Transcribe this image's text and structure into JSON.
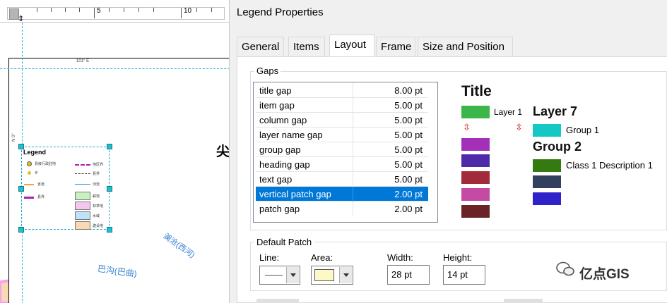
{
  "map": {
    "ruler": {
      "labels": [
        "5",
        "10"
      ]
    },
    "coord_top": "101° E",
    "coord_left": "N 0°",
    "place_label": "尖",
    "river_labels": [
      "巴沟(巴曲)",
      "澜沧(西河)"
    ],
    "legend": {
      "title": "Legend",
      "left_items": [
        "县级行政驻地",
        "乡",
        "省道",
        "县界"
      ],
      "mid_items": [
        "地区界",
        "县界",
        "河流"
      ],
      "swatch_labels": [
        "耕地",
        "林草地",
        "水域",
        "建设地"
      ]
    }
  },
  "dialog": {
    "title": "Legend Properties",
    "tabs": [
      {
        "label": "General"
      },
      {
        "label": "Items"
      },
      {
        "label": "Layout"
      },
      {
        "label": "Frame"
      },
      {
        "label": "Size and Position"
      }
    ],
    "active_tab": "Layout",
    "gaps": {
      "label": "Gaps",
      "rows": [
        {
          "name": "title gap",
          "value": "8.00 pt"
        },
        {
          "name": "item gap",
          "value": "5.00 pt"
        },
        {
          "name": "column gap",
          "value": "5.00 pt"
        },
        {
          "name": "layer name gap",
          "value": "5.00 pt"
        },
        {
          "name": "group gap",
          "value": "5.00 pt"
        },
        {
          "name": "heading gap",
          "value": "5.00 pt"
        },
        {
          "name": "text gap",
          "value": "5.00 pt"
        },
        {
          "name": "vertical patch gap",
          "value": "2.00 pt"
        },
        {
          "name": "patch gap",
          "value": "2.00 pt"
        }
      ],
      "selected_row": "vertical patch gap"
    },
    "preview": {
      "title": "Title",
      "layer1": "Layer 1",
      "layer7": "Layer 7",
      "group1": "Group 1",
      "group2": "Group 2",
      "class1": "Class 1 Description 1",
      "colors": {
        "layer1_patch": "#3cb54a",
        "left_patches": [
          "#a330b8",
          "#4e2aa8",
          "#a22a3a",
          "#c44aa4",
          "#6a2428"
        ],
        "group1_patch": "#16c8c4",
        "class1_patch": "#347a10",
        "right_patches": [
          "#32405e",
          "#2e22c8"
        ]
      }
    },
    "default_patch": {
      "label": "Default Patch",
      "line_label": "Line:",
      "area_label": "Area:",
      "width_label": "Width:",
      "height_label": "Height:",
      "width_value": "28 pt",
      "height_value": "14 pt",
      "area_color": "#fdf9c6"
    },
    "watermark": "亿点GIS"
  },
  "colors": {
    "selection": "#0078d7",
    "guide": "#29b6d6",
    "region_pink": "#f6c6f0",
    "region_green": "#c8f0c0",
    "region_tan": "#f8d9b4",
    "boundary_magenta": "#f3a3ef"
  }
}
